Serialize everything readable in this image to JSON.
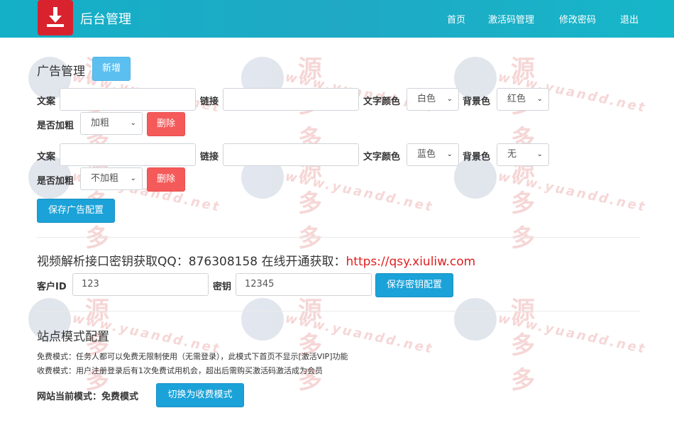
{
  "header": {
    "brand": "后台管理",
    "nav": [
      "首页",
      "激活码管理",
      "修改密码",
      "退出"
    ]
  },
  "ads": {
    "title": "广告管理",
    "new_button": "新增",
    "labels": {
      "text": "文案",
      "link": "链接",
      "color": "文字颜色",
      "bg": "背景色",
      "bold": "是否加粗"
    },
    "rows": [
      {
        "text": "",
        "link": "",
        "color": "白色",
        "bg": "红色",
        "bold": "加粗",
        "delete": "删除"
      },
      {
        "text": "",
        "link": "",
        "color": "蓝色",
        "bg": "无",
        "bold": "不加粗",
        "delete": "删除"
      }
    ],
    "save_button": "保存广告配置"
  },
  "api": {
    "title": "视频解析接口密钥获取QQ：876308158 在线开通获取：",
    "link": "https://qsy.xiuliw.com",
    "client_label": "客户ID",
    "client_value": "123",
    "key_label": "密钥",
    "key_value": "12345",
    "save_button": "保存密钥配置"
  },
  "mode": {
    "title": "站点模式配置",
    "free_desc": "免费模式：任务人都可以免费无限制使用（无需登录），此模式下首页不显示[激活VIP]功能",
    "paid_desc": "收费模式：用户注册登录后有1次免费试用机会，超出后需购买激活码激活成为会员",
    "current": "网站当前模式：免费模式",
    "switch_button": "切换为收费模式"
  },
  "watermark": {
    "text": "源多多",
    "url": "www.yuandd.net"
  },
  "colors": {
    "header": "#17b0c7",
    "primary": "#1ba2d8",
    "danger": "#f55a5a",
    "link": "#e02020"
  }
}
